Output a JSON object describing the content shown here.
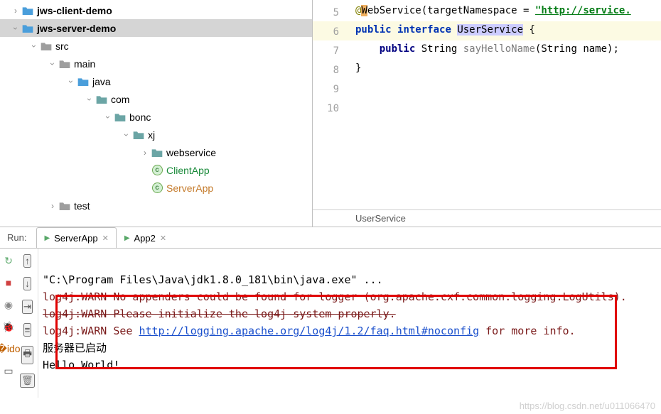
{
  "tree": {
    "jws_client": "jws-client-demo",
    "jws_server": "jws-server-demo",
    "src": "src",
    "main": "main",
    "java": "java",
    "com": "com",
    "bonc": "bonc",
    "xj": "xj",
    "webservice": "webservice",
    "clientapp": "ClientApp",
    "serverapp": "ServerApp",
    "test": "test"
  },
  "editor": {
    "lines": {
      "5": {
        "ann": "@",
        "ann2": "ebService",
        "paren": "(targetNamespace = ",
        "str": "\"http://service."
      },
      "6": {
        "kw1": "public ",
        "kw2": "interface ",
        "name": "UserService",
        " rest": " {"
      },
      "7": {
        "indent": "    ",
        "kw": "public ",
        "type": "String ",
        "method": "sayHelloName",
        "params": "(String name);"
      },
      "8": "}",
      "9": "",
      "10": ""
    },
    "breadcrumb": "UserService"
  },
  "run": {
    "label": "Run:",
    "tab1": "ServerApp",
    "tab2": "App2"
  },
  "console": {
    "l1": "\"C:\\Program Files\\Java\\jdk1.8.0_181\\bin\\java.exe\" ...",
    "l2": "log4j:WARN No appenders could be found for logger (org.apache.cxf.common.logging.LogUtils).",
    "l3": "log4j:WARN Please initialize the log4j system properly.",
    "l4a": "log4j:WARN See ",
    "l4link": "http://logging.apache.org/log4j/1.2/faq.html#noconfig",
    "l4b": " for more info.",
    "l5": "服务器已启动",
    "l6": "Hello World!"
  },
  "watermark": "https://blog.csdn.net/u011066470"
}
